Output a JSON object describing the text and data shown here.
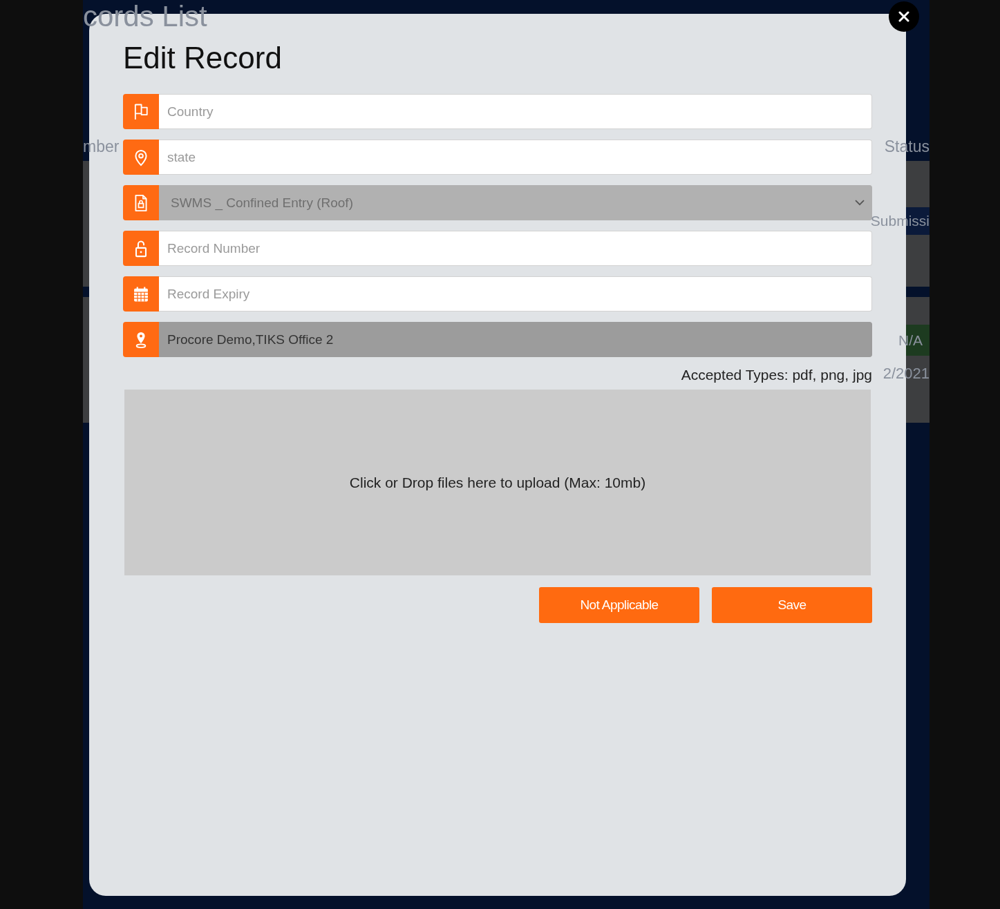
{
  "background_page": {
    "title": "cords List",
    "column_headers": [
      "mber",
      "Status"
    ],
    "rows": [
      {
        "status": "Submissi",
        "color": "#0b1a3a"
      },
      {
        "status": "N/A",
        "color": "#1d3b20",
        "date": "2/2021"
      }
    ]
  },
  "modal": {
    "title": "Edit Record",
    "fields": [
      {
        "kind": "input",
        "placeholder": "Country",
        "disabled": false
      },
      {
        "kind": "input",
        "placeholder": "state",
        "disabled": false
      },
      {
        "kind": "select",
        "value": "SWMS _ Confined Entry (Roof)",
        "disabled": true
      },
      {
        "kind": "input",
        "placeholder": "Record Number",
        "disabled": false
      },
      {
        "kind": "input",
        "placeholder": "Record Expiry",
        "disabled": false
      },
      {
        "kind": "input",
        "value": "Procore Demo,TIKS Office 2",
        "disabled": true
      }
    ],
    "accepted_types": "Accepted Types: pdf, png, jpg",
    "drop_zone": "Click or Drop files here to upload (Max: 10mb)",
    "buttons": [
      "Not Applicable",
      "Save"
    ]
  }
}
